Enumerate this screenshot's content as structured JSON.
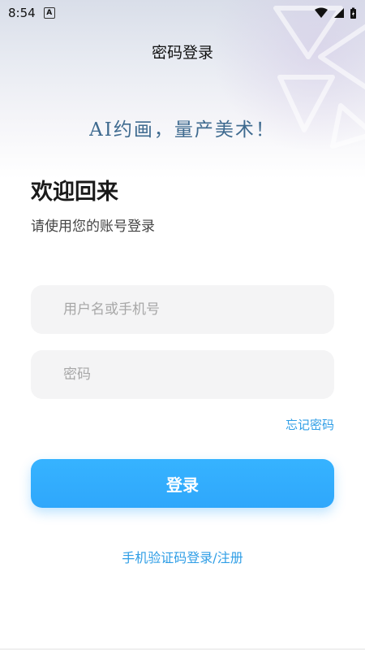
{
  "status_bar": {
    "time": "8:54",
    "icons": [
      "app-a-icon",
      "wifi-icon",
      "signal-icon",
      "battery-icon"
    ]
  },
  "header": {
    "title": "密码登录",
    "slogan": "AI约画，量产美术！"
  },
  "welcome": {
    "title": "欢迎回来",
    "subtitle": "请使用您的账号登录"
  },
  "form": {
    "username_placeholder": "用户名或手机号",
    "username_value": "",
    "password_placeholder": "密码",
    "password_value": "",
    "forgot_label": "忘记密码",
    "login_label": "登录",
    "alt_login_label": "手机验证码登录/注册"
  },
  "colors": {
    "primary": "#2fa7fb",
    "link": "#2f9ee6",
    "slogan": "#3e6a8f",
    "input_bg": "#f4f4f5"
  }
}
